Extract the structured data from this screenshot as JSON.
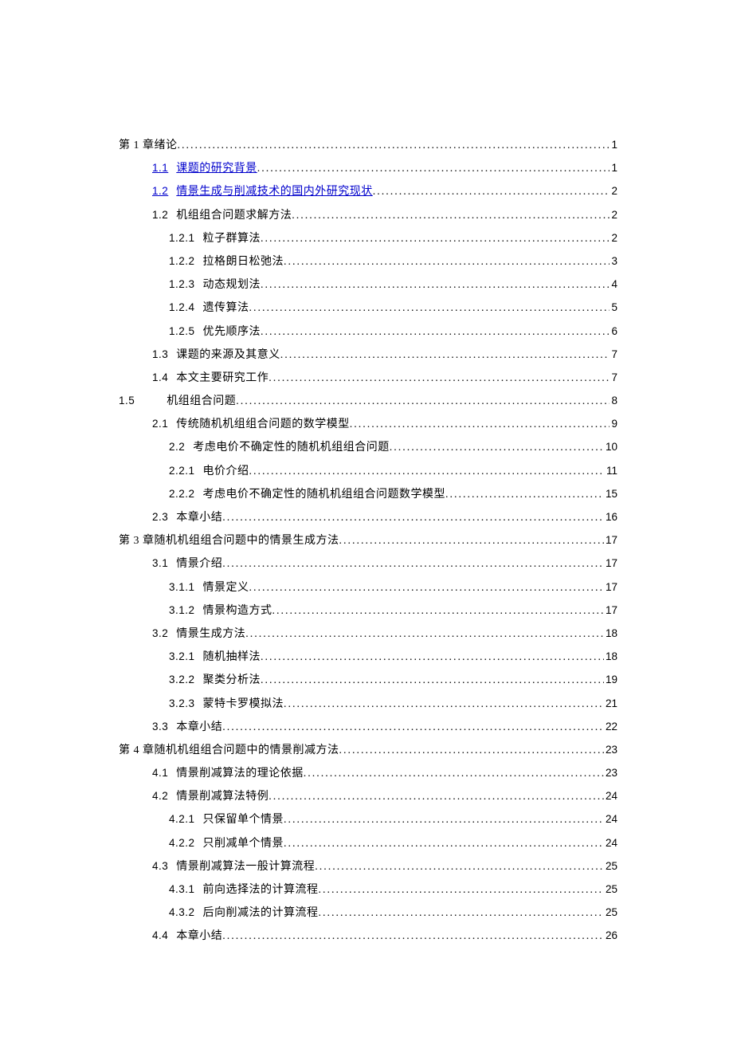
{
  "toc": [
    {
      "indent": 0,
      "num": "第 1 章",
      "title": "绪论",
      "page": "1",
      "link": false,
      "titleLink": false
    },
    {
      "indent": 1,
      "num": "1.1",
      "title": "课题的研究背景",
      "page": "1",
      "link": true,
      "titleLink": true
    },
    {
      "indent": 1,
      "num": "1.2",
      "title": "情景生成与削减技术的国内外研究现状",
      "page": "2",
      "link": true,
      "titleLink": true
    },
    {
      "indent": 1,
      "num": "1.2",
      "title": "机组组合问题求解方法",
      "page": "2",
      "link": false,
      "titleLink": false
    },
    {
      "indent": 2,
      "num": "1.2.1",
      "title": "粒子群算法",
      "page": "2",
      "link": false,
      "titleLink": false
    },
    {
      "indent": 2,
      "num": "1.2.2",
      "title": "拉格朗日松弛法",
      "page": "3",
      "link": false,
      "titleLink": false
    },
    {
      "indent": 2,
      "num": "1.2.3",
      "title": "动态规划法",
      "page": "4",
      "link": false,
      "titleLink": false
    },
    {
      "indent": 2,
      "num": "1.2.4",
      "title": "遗传算法",
      "page": "5",
      "link": false,
      "titleLink": false
    },
    {
      "indent": 2,
      "num": "1.2.5",
      "title": "优先顺序法",
      "page": "6",
      "link": false,
      "titleLink": false
    },
    {
      "indent": 1,
      "num": "1.3",
      "title": "课题的来源及其意义",
      "page": "7",
      "link": false,
      "titleLink": false
    },
    {
      "indent": 1,
      "num": "1.4",
      "title": "本文主要研究工作",
      "page": "7",
      "link": false,
      "titleLink": false
    },
    {
      "indent": 0,
      "num": "1.5",
      "title": "机组组合问题",
      "page": "8",
      "link": false,
      "titleLink": false,
      "special15": true
    },
    {
      "indent": 1,
      "num": "2.1",
      "title": "传统随机机组组合问题的数学模型",
      "page": "9",
      "link": false,
      "titleLink": false
    },
    {
      "indent": 2,
      "num": "2.2",
      "title": "考虑电价不确定性的随机机组组合问题",
      "page": "10",
      "link": false,
      "titleLink": false
    },
    {
      "indent": 2,
      "num": "2.2.1",
      "title": "电价介绍",
      "page": "11",
      "link": false,
      "titleLink": false
    },
    {
      "indent": 2,
      "num": "2.2.2",
      "title": "考虑电价不确定性的随机机组组合问题数学模型",
      "page": "15",
      "link": false,
      "titleLink": false
    },
    {
      "indent": 1,
      "num": "2.3",
      "title": "本章小结",
      "page": "16",
      "link": false,
      "titleLink": false
    },
    {
      "indent": 0,
      "num": "第 3 章",
      "title": "随机机组组合问题中的情景生成方法",
      "page": "17",
      "link": false,
      "titleLink": false
    },
    {
      "indent": 1,
      "num": "3.1",
      "title": "情景介绍",
      "page": "17",
      "link": false,
      "titleLink": false
    },
    {
      "indent": 2,
      "num": "3.1.1",
      "title": "情景定义",
      "page": "17",
      "link": false,
      "titleLink": false
    },
    {
      "indent": 2,
      "num": "3.1.2",
      "title": "情景构造方式",
      "page": "17",
      "link": false,
      "titleLink": false
    },
    {
      "indent": 1,
      "num": "3.2",
      "title": "情景生成方法",
      "page": "18",
      "link": false,
      "titleLink": false
    },
    {
      "indent": 2,
      "num": "3.2.1",
      "title": "随机抽样法",
      "page": "18",
      "link": false,
      "titleLink": false
    },
    {
      "indent": 2,
      "num": "3.2.2",
      "title": "聚类分析法",
      "page": "19",
      "link": false,
      "titleLink": false
    },
    {
      "indent": 2,
      "num": "3.2.3",
      "title": "蒙特卡罗模拟法",
      "page": "21",
      "link": false,
      "titleLink": false
    },
    {
      "indent": 1,
      "num": "3.3",
      "title": "本章小结",
      "page": "22",
      "link": false,
      "titleLink": false
    },
    {
      "indent": 0,
      "num": "第 4 章",
      "title": "随机机组组合问题中的情景削减方法",
      "page": "23",
      "link": false,
      "titleLink": false
    },
    {
      "indent": 1,
      "num": "4.1",
      "title": "情景削减算法的理论依据",
      "page": "23",
      "link": false,
      "titleLink": false
    },
    {
      "indent": 1,
      "num": "4.2",
      "title": "情景削减算法特例",
      "page": "24",
      "link": false,
      "titleLink": false
    },
    {
      "indent": 2,
      "num": "4.2.1",
      "title": "只保留单个情景",
      "page": "24",
      "link": false,
      "titleLink": false
    },
    {
      "indent": 2,
      "num": "4.2.2",
      "title": "只削减单个情景",
      "page": "24",
      "link": false,
      "titleLink": false
    },
    {
      "indent": 1,
      "num": "4.3",
      "title": "情景削减算法一般计算流程",
      "page": "25",
      "link": false,
      "titleLink": false
    },
    {
      "indent": 2,
      "num": "4.3.1",
      "title": "前向选择法的计算流程",
      "page": "25",
      "link": false,
      "titleLink": false
    },
    {
      "indent": 2,
      "num": "4.3.2",
      "title": "后向削减法的计算流程",
      "page": "25",
      "link": false,
      "titleLink": false
    },
    {
      "indent": 1,
      "num": "4.4",
      "title": "本章小结",
      "page": "26",
      "link": false,
      "titleLink": false
    }
  ]
}
